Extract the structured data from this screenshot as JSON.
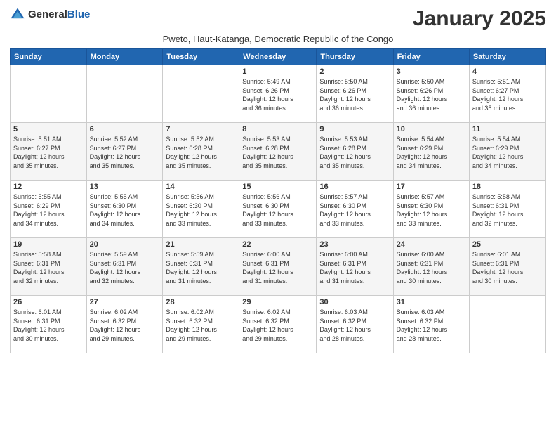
{
  "logo": {
    "general": "General",
    "blue": "Blue"
  },
  "header": {
    "month_title": "January 2025",
    "subtitle": "Pweto, Haut-Katanga, Democratic Republic of the Congo"
  },
  "days_of_week": [
    "Sunday",
    "Monday",
    "Tuesday",
    "Wednesday",
    "Thursday",
    "Friday",
    "Saturday"
  ],
  "weeks": [
    [
      {
        "day": "",
        "info": ""
      },
      {
        "day": "",
        "info": ""
      },
      {
        "day": "",
        "info": ""
      },
      {
        "day": "1",
        "info": "Sunrise: 5:49 AM\nSunset: 6:26 PM\nDaylight: 12 hours\nand 36 minutes."
      },
      {
        "day": "2",
        "info": "Sunrise: 5:50 AM\nSunset: 6:26 PM\nDaylight: 12 hours\nand 36 minutes."
      },
      {
        "day": "3",
        "info": "Sunrise: 5:50 AM\nSunset: 6:26 PM\nDaylight: 12 hours\nand 36 minutes."
      },
      {
        "day": "4",
        "info": "Sunrise: 5:51 AM\nSunset: 6:27 PM\nDaylight: 12 hours\nand 35 minutes."
      }
    ],
    [
      {
        "day": "5",
        "info": "Sunrise: 5:51 AM\nSunset: 6:27 PM\nDaylight: 12 hours\nand 35 minutes."
      },
      {
        "day": "6",
        "info": "Sunrise: 5:52 AM\nSunset: 6:27 PM\nDaylight: 12 hours\nand 35 minutes."
      },
      {
        "day": "7",
        "info": "Sunrise: 5:52 AM\nSunset: 6:28 PM\nDaylight: 12 hours\nand 35 minutes."
      },
      {
        "day": "8",
        "info": "Sunrise: 5:53 AM\nSunset: 6:28 PM\nDaylight: 12 hours\nand 35 minutes."
      },
      {
        "day": "9",
        "info": "Sunrise: 5:53 AM\nSunset: 6:28 PM\nDaylight: 12 hours\nand 35 minutes."
      },
      {
        "day": "10",
        "info": "Sunrise: 5:54 AM\nSunset: 6:29 PM\nDaylight: 12 hours\nand 34 minutes."
      },
      {
        "day": "11",
        "info": "Sunrise: 5:54 AM\nSunset: 6:29 PM\nDaylight: 12 hours\nand 34 minutes."
      }
    ],
    [
      {
        "day": "12",
        "info": "Sunrise: 5:55 AM\nSunset: 6:29 PM\nDaylight: 12 hours\nand 34 minutes."
      },
      {
        "day": "13",
        "info": "Sunrise: 5:55 AM\nSunset: 6:30 PM\nDaylight: 12 hours\nand 34 minutes."
      },
      {
        "day": "14",
        "info": "Sunrise: 5:56 AM\nSunset: 6:30 PM\nDaylight: 12 hours\nand 33 minutes."
      },
      {
        "day": "15",
        "info": "Sunrise: 5:56 AM\nSunset: 6:30 PM\nDaylight: 12 hours\nand 33 minutes."
      },
      {
        "day": "16",
        "info": "Sunrise: 5:57 AM\nSunset: 6:30 PM\nDaylight: 12 hours\nand 33 minutes."
      },
      {
        "day": "17",
        "info": "Sunrise: 5:57 AM\nSunset: 6:30 PM\nDaylight: 12 hours\nand 33 minutes."
      },
      {
        "day": "18",
        "info": "Sunrise: 5:58 AM\nSunset: 6:31 PM\nDaylight: 12 hours\nand 32 minutes."
      }
    ],
    [
      {
        "day": "19",
        "info": "Sunrise: 5:58 AM\nSunset: 6:31 PM\nDaylight: 12 hours\nand 32 minutes."
      },
      {
        "day": "20",
        "info": "Sunrise: 5:59 AM\nSunset: 6:31 PM\nDaylight: 12 hours\nand 32 minutes."
      },
      {
        "day": "21",
        "info": "Sunrise: 5:59 AM\nSunset: 6:31 PM\nDaylight: 12 hours\nand 31 minutes."
      },
      {
        "day": "22",
        "info": "Sunrise: 6:00 AM\nSunset: 6:31 PM\nDaylight: 12 hours\nand 31 minutes."
      },
      {
        "day": "23",
        "info": "Sunrise: 6:00 AM\nSunset: 6:31 PM\nDaylight: 12 hours\nand 31 minutes."
      },
      {
        "day": "24",
        "info": "Sunrise: 6:00 AM\nSunset: 6:31 PM\nDaylight: 12 hours\nand 30 minutes."
      },
      {
        "day": "25",
        "info": "Sunrise: 6:01 AM\nSunset: 6:31 PM\nDaylight: 12 hours\nand 30 minutes."
      }
    ],
    [
      {
        "day": "26",
        "info": "Sunrise: 6:01 AM\nSunset: 6:31 PM\nDaylight: 12 hours\nand 30 minutes."
      },
      {
        "day": "27",
        "info": "Sunrise: 6:02 AM\nSunset: 6:32 PM\nDaylight: 12 hours\nand 29 minutes."
      },
      {
        "day": "28",
        "info": "Sunrise: 6:02 AM\nSunset: 6:32 PM\nDaylight: 12 hours\nand 29 minutes."
      },
      {
        "day": "29",
        "info": "Sunrise: 6:02 AM\nSunset: 6:32 PM\nDaylight: 12 hours\nand 29 minutes."
      },
      {
        "day": "30",
        "info": "Sunrise: 6:03 AM\nSunset: 6:32 PM\nDaylight: 12 hours\nand 28 minutes."
      },
      {
        "day": "31",
        "info": "Sunrise: 6:03 AM\nSunset: 6:32 PM\nDaylight: 12 hours\nand 28 minutes."
      },
      {
        "day": "",
        "info": ""
      }
    ]
  ]
}
